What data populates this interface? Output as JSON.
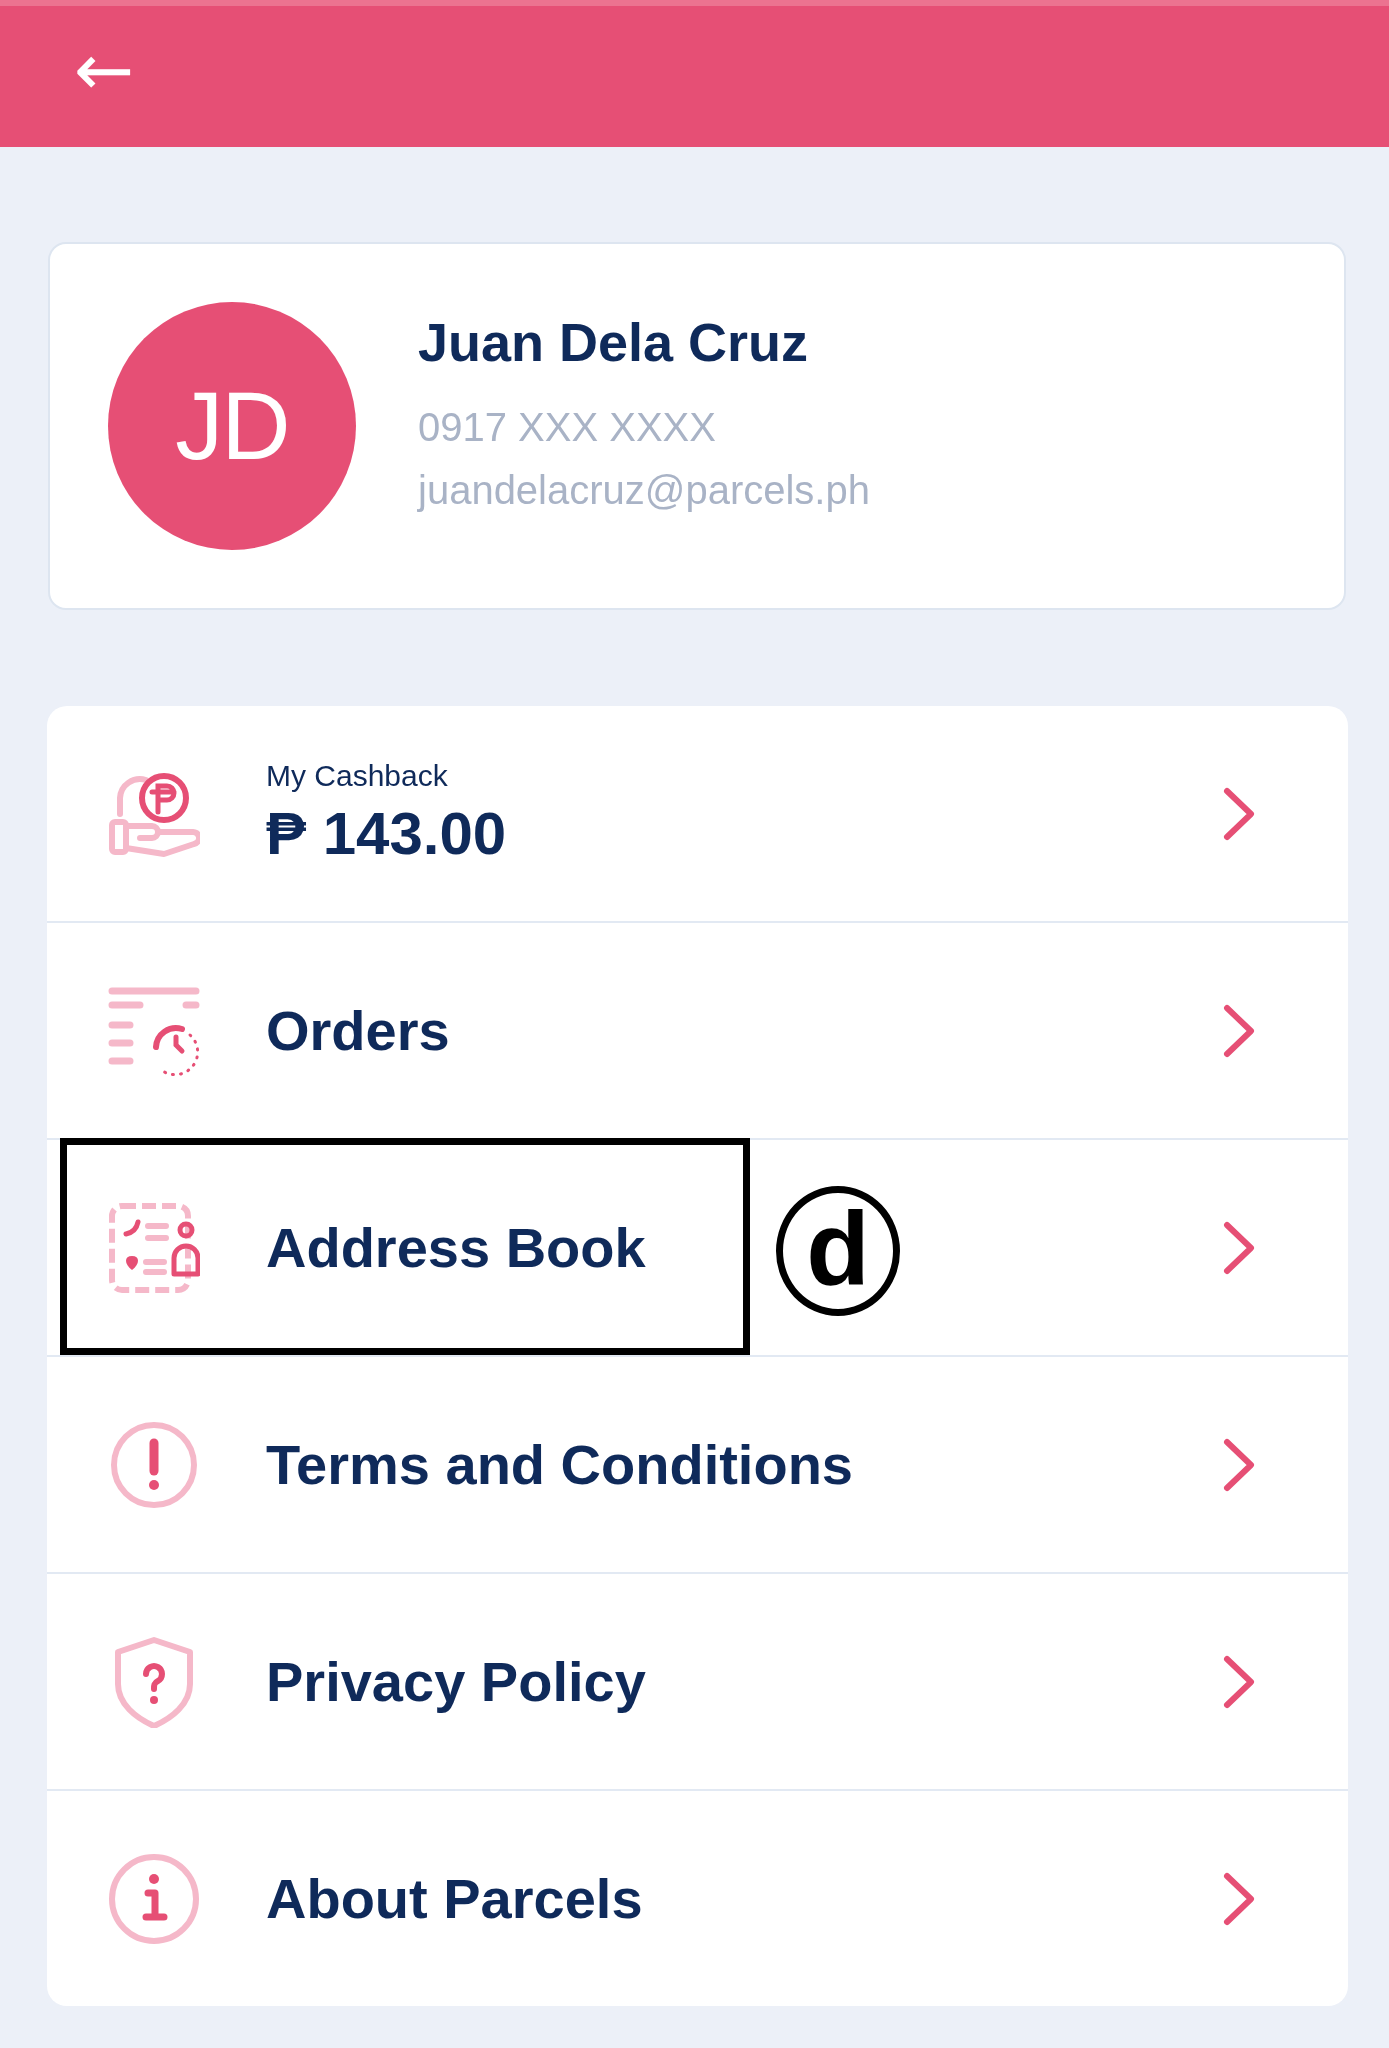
{
  "header": {
    "back": "←"
  },
  "profile": {
    "initials": "JD",
    "name": "Juan Dela Cruz",
    "phone": "0917 XXX XXXX",
    "email": "juandelacruz@parcels.ph"
  },
  "menu": [
    {
      "kind": "cashback",
      "label": "My Cashback",
      "value": "₱ 143.00"
    },
    {
      "kind": "link",
      "label": "Orders"
    },
    {
      "kind": "link",
      "label": "Address Book",
      "annotation": {
        "label": "d"
      }
    },
    {
      "kind": "link",
      "label": "Terms and Conditions"
    },
    {
      "kind": "link",
      "label": "Privacy Policy"
    },
    {
      "kind": "link",
      "label": "About Parcels"
    }
  ]
}
